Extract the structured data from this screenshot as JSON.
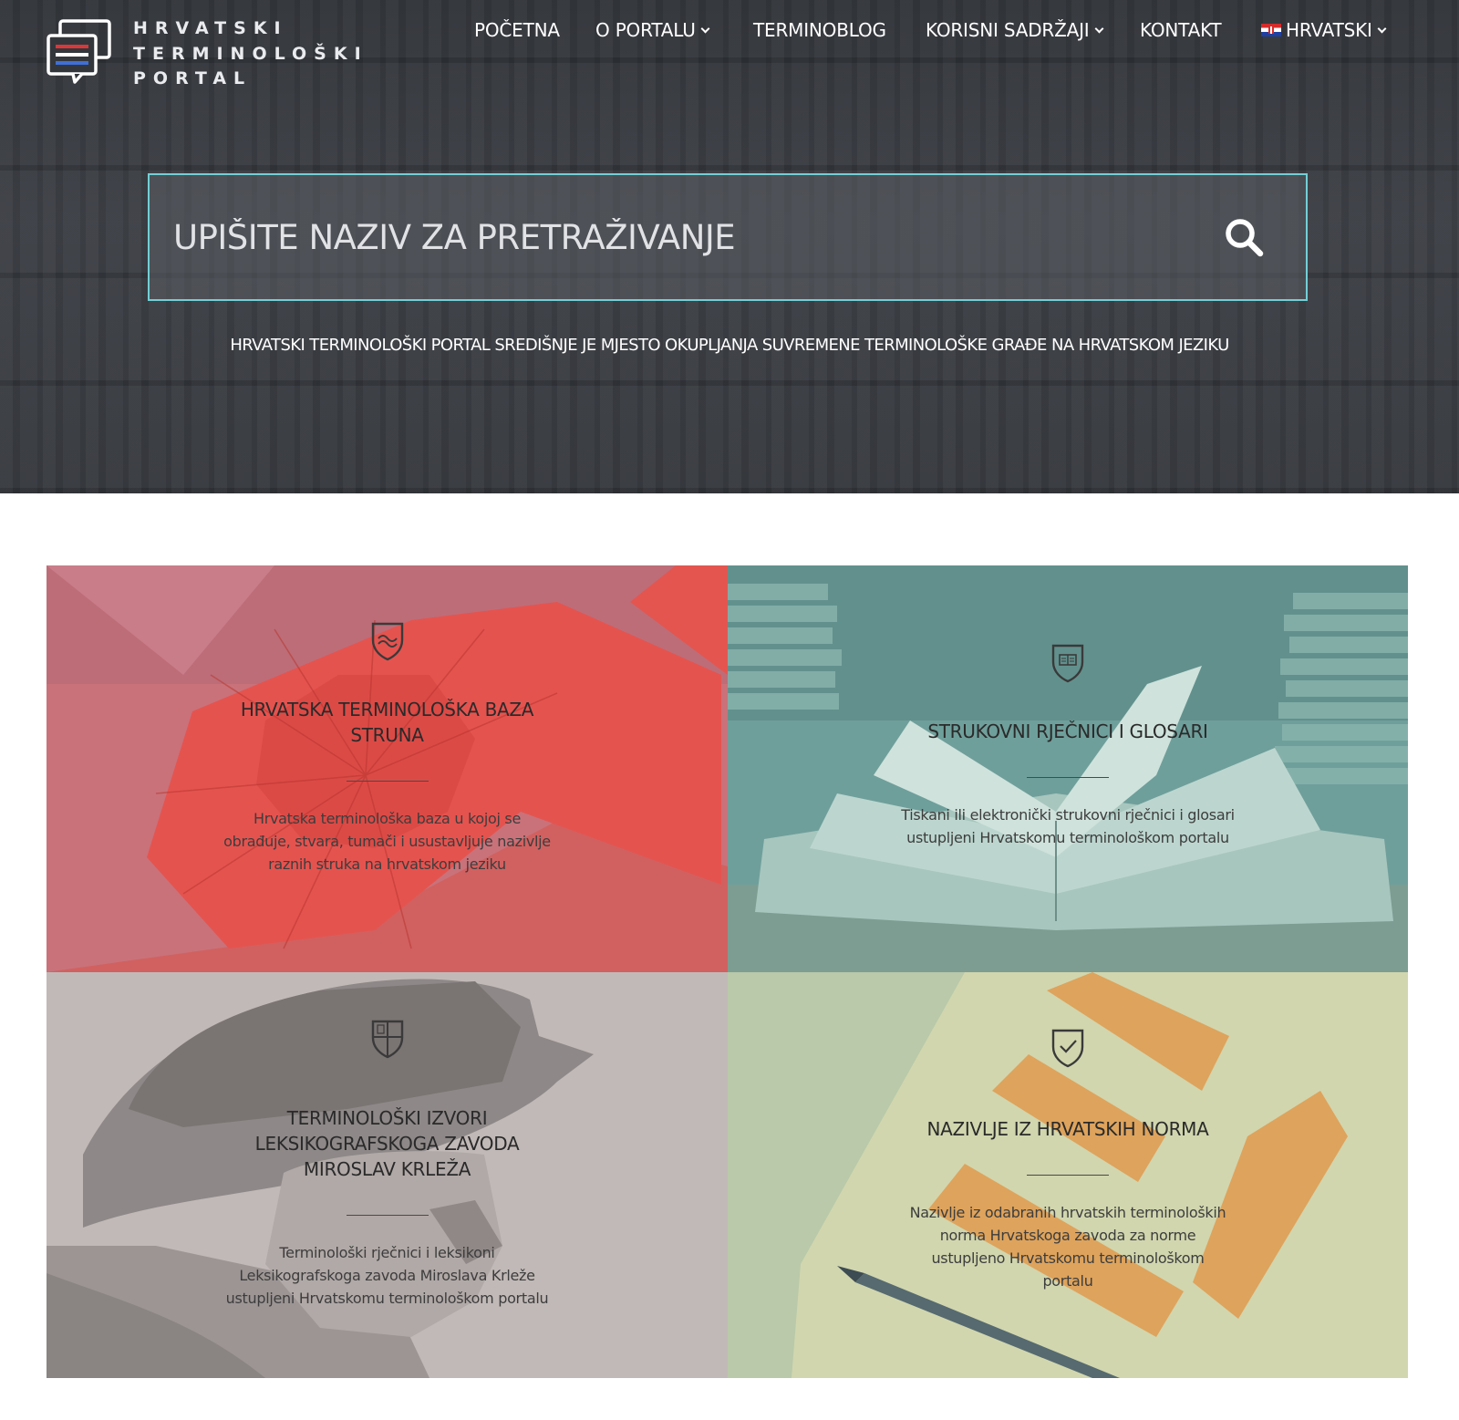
{
  "logo": {
    "line1": "HRVATSKI",
    "line2": "TERMINOLOŠKI",
    "line3": "PORTAL"
  },
  "nav": {
    "items": [
      {
        "label": "POČETNA",
        "dropdown": false
      },
      {
        "label": "O PORTALU",
        "dropdown": true
      },
      {
        "label": "TERMINOBLOG",
        "dropdown": false
      },
      {
        "label": "KORISNI SADRŽAJI",
        "dropdown": true
      },
      {
        "label": "KONTAKT",
        "dropdown": false
      }
    ],
    "language": {
      "label": "HRVATSKI",
      "flag_icon": "croatian-flag-icon"
    }
  },
  "search": {
    "placeholder": "UPIŠITE NAZIV ZA PRETRAŽIVANJE",
    "value": "",
    "button_icon": "search-icon",
    "border_color": "#73cfd6"
  },
  "tagline": "HRVATSKI TERMINOLOŠKI PORTAL SREDIŠNJE JE MJESTO OKUPLJANJA SUVREMENE TERMINOLOŠKE GRAĐE NA HRVATSKOM JEZIKU",
  "tiles": [
    {
      "title_lines": [
        "HRVATSKA TERMINOLOŠKA BAZA",
        "STRUNA"
      ],
      "description_lines": [
        "Hrvatska terminološka baza u kojoj se",
        "obrađuje, stvara, tumači i usustavljuje nazivlje",
        "raznih struka na hrvatskom jeziku"
      ],
      "icon": "shield-wave-icon",
      "tint": "#e0605d"
    },
    {
      "title_lines": [
        "STRUKOVNI RJEČNICI I GLOSARI"
      ],
      "description_lines": [
        "Tiskani ili elektronički strukovni rječnici i glosari",
        "ustupljeni Hrvatskomu terminološkom portalu"
      ],
      "icon": "shield-book-icon",
      "tint": "#7eaaa4"
    },
    {
      "title_lines": [
        "TERMINOLOŠKI IZVORI",
        "LEKSIKOGRAFSKOGA ZAVODA",
        "MIROSLAV KRLEŽA"
      ],
      "description_lines": [
        "Terminološki rječnici i leksikoni",
        "Leksikografskoga zavoda Miroslava Krleže",
        "ustupljeni Hrvatskomu terminološkom portalu"
      ],
      "icon": "shield-quarters-icon",
      "tint": "#c2bab8"
    },
    {
      "title_lines": [
        "NAZIVLJE IZ HRVATSKIH NORMA"
      ],
      "description_lines": [
        "Nazivlje iz odabranih hrvatskih terminoloških",
        "norma Hrvatskoga zavoda za norme",
        "ustupljeno Hrvatskomu terminološkom",
        "portalu"
      ],
      "icon": "shield-check-icon",
      "tint": "#bfcda8"
    }
  ]
}
